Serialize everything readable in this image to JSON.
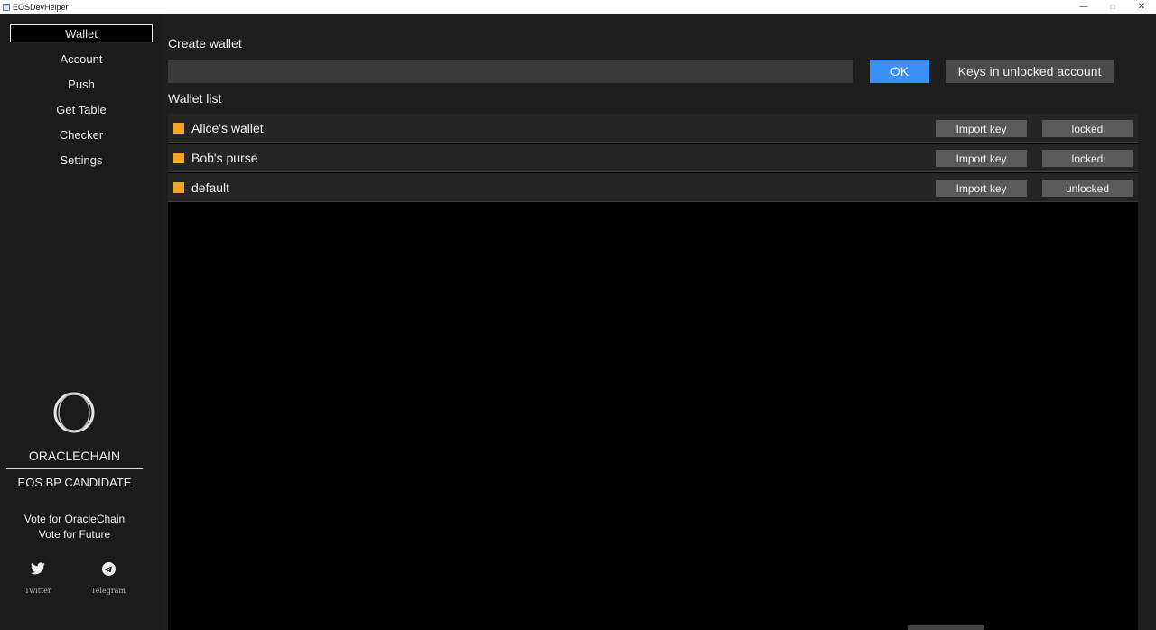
{
  "window": {
    "title": "EOSDevHelper",
    "minimize_glyph": "—",
    "restore_glyph": "▫",
    "close_glyph": "✕"
  },
  "sidebar": {
    "items": [
      {
        "label": "Wallet",
        "active": true
      },
      {
        "label": "Account",
        "active": false
      },
      {
        "label": "Push",
        "active": false
      },
      {
        "label": "Get Table",
        "active": false
      },
      {
        "label": "Checker",
        "active": false
      },
      {
        "label": "Settings",
        "active": false
      }
    ],
    "brand": {
      "name": "ORACLECHAIN",
      "subtitle": "EOS BP CANDIDATE",
      "vote_line1": "Vote for OracleChain",
      "vote_line2": "Vote for Future"
    },
    "social": [
      {
        "label": "Twitter",
        "icon": "twitter-icon"
      },
      {
        "label": "Telegram",
        "icon": "telegram-icon"
      }
    ]
  },
  "main": {
    "create_label": "Create wallet",
    "create_input_value": "",
    "ok_label": "OK",
    "keys_label": "Keys in unlocked account",
    "list_label": "Wallet list",
    "wallets": [
      {
        "name": "Alice's wallet",
        "import_label": "Import key",
        "status_label": "locked"
      },
      {
        "name": "Bob's purse",
        "import_label": "Import key",
        "status_label": "locked"
      },
      {
        "name": "default",
        "import_label": "Import key",
        "status_label": "unlocked"
      }
    ]
  },
  "colors": {
    "accent": "#3b8ef3",
    "wallet_swatch": "#f5a623",
    "background": "#1b1b1b"
  }
}
